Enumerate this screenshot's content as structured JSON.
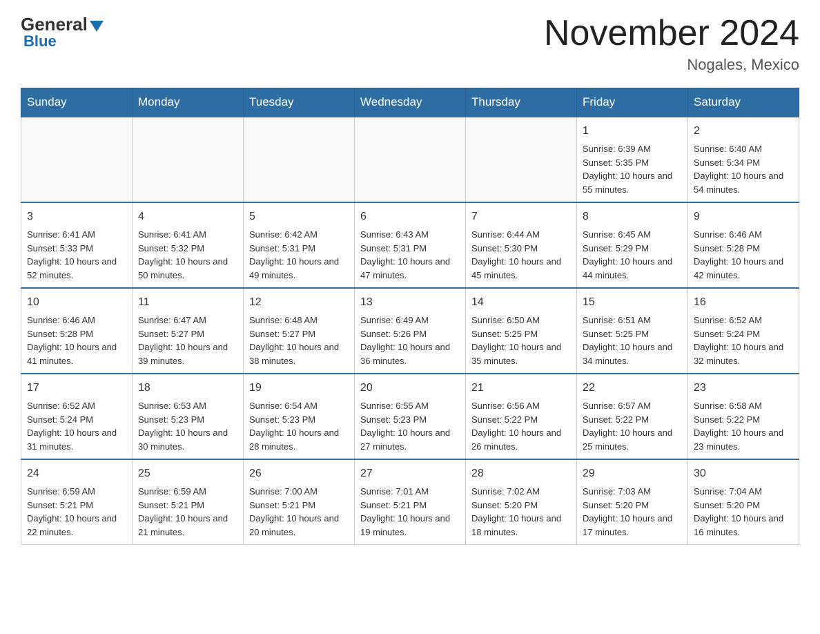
{
  "logo": {
    "general": "General",
    "blue": "Blue"
  },
  "header": {
    "title": "November 2024",
    "location": "Nogales, Mexico"
  },
  "days_of_week": [
    "Sunday",
    "Monday",
    "Tuesday",
    "Wednesday",
    "Thursday",
    "Friday",
    "Saturday"
  ],
  "weeks": [
    [
      {
        "day": "",
        "info": ""
      },
      {
        "day": "",
        "info": ""
      },
      {
        "day": "",
        "info": ""
      },
      {
        "day": "",
        "info": ""
      },
      {
        "day": "",
        "info": ""
      },
      {
        "day": "1",
        "info": "Sunrise: 6:39 AM\nSunset: 5:35 PM\nDaylight: 10 hours and 55 minutes."
      },
      {
        "day": "2",
        "info": "Sunrise: 6:40 AM\nSunset: 5:34 PM\nDaylight: 10 hours and 54 minutes."
      }
    ],
    [
      {
        "day": "3",
        "info": "Sunrise: 6:41 AM\nSunset: 5:33 PM\nDaylight: 10 hours and 52 minutes."
      },
      {
        "day": "4",
        "info": "Sunrise: 6:41 AM\nSunset: 5:32 PM\nDaylight: 10 hours and 50 minutes."
      },
      {
        "day": "5",
        "info": "Sunrise: 6:42 AM\nSunset: 5:31 PM\nDaylight: 10 hours and 49 minutes."
      },
      {
        "day": "6",
        "info": "Sunrise: 6:43 AM\nSunset: 5:31 PM\nDaylight: 10 hours and 47 minutes."
      },
      {
        "day": "7",
        "info": "Sunrise: 6:44 AM\nSunset: 5:30 PM\nDaylight: 10 hours and 45 minutes."
      },
      {
        "day": "8",
        "info": "Sunrise: 6:45 AM\nSunset: 5:29 PM\nDaylight: 10 hours and 44 minutes."
      },
      {
        "day": "9",
        "info": "Sunrise: 6:46 AM\nSunset: 5:28 PM\nDaylight: 10 hours and 42 minutes."
      }
    ],
    [
      {
        "day": "10",
        "info": "Sunrise: 6:46 AM\nSunset: 5:28 PM\nDaylight: 10 hours and 41 minutes."
      },
      {
        "day": "11",
        "info": "Sunrise: 6:47 AM\nSunset: 5:27 PM\nDaylight: 10 hours and 39 minutes."
      },
      {
        "day": "12",
        "info": "Sunrise: 6:48 AM\nSunset: 5:27 PM\nDaylight: 10 hours and 38 minutes."
      },
      {
        "day": "13",
        "info": "Sunrise: 6:49 AM\nSunset: 5:26 PM\nDaylight: 10 hours and 36 minutes."
      },
      {
        "day": "14",
        "info": "Sunrise: 6:50 AM\nSunset: 5:25 PM\nDaylight: 10 hours and 35 minutes."
      },
      {
        "day": "15",
        "info": "Sunrise: 6:51 AM\nSunset: 5:25 PM\nDaylight: 10 hours and 34 minutes."
      },
      {
        "day": "16",
        "info": "Sunrise: 6:52 AM\nSunset: 5:24 PM\nDaylight: 10 hours and 32 minutes."
      }
    ],
    [
      {
        "day": "17",
        "info": "Sunrise: 6:52 AM\nSunset: 5:24 PM\nDaylight: 10 hours and 31 minutes."
      },
      {
        "day": "18",
        "info": "Sunrise: 6:53 AM\nSunset: 5:23 PM\nDaylight: 10 hours and 30 minutes."
      },
      {
        "day": "19",
        "info": "Sunrise: 6:54 AM\nSunset: 5:23 PM\nDaylight: 10 hours and 28 minutes."
      },
      {
        "day": "20",
        "info": "Sunrise: 6:55 AM\nSunset: 5:23 PM\nDaylight: 10 hours and 27 minutes."
      },
      {
        "day": "21",
        "info": "Sunrise: 6:56 AM\nSunset: 5:22 PM\nDaylight: 10 hours and 26 minutes."
      },
      {
        "day": "22",
        "info": "Sunrise: 6:57 AM\nSunset: 5:22 PM\nDaylight: 10 hours and 25 minutes."
      },
      {
        "day": "23",
        "info": "Sunrise: 6:58 AM\nSunset: 5:22 PM\nDaylight: 10 hours and 23 minutes."
      }
    ],
    [
      {
        "day": "24",
        "info": "Sunrise: 6:59 AM\nSunset: 5:21 PM\nDaylight: 10 hours and 22 minutes."
      },
      {
        "day": "25",
        "info": "Sunrise: 6:59 AM\nSunset: 5:21 PM\nDaylight: 10 hours and 21 minutes."
      },
      {
        "day": "26",
        "info": "Sunrise: 7:00 AM\nSunset: 5:21 PM\nDaylight: 10 hours and 20 minutes."
      },
      {
        "day": "27",
        "info": "Sunrise: 7:01 AM\nSunset: 5:21 PM\nDaylight: 10 hours and 19 minutes."
      },
      {
        "day": "28",
        "info": "Sunrise: 7:02 AM\nSunset: 5:20 PM\nDaylight: 10 hours and 18 minutes."
      },
      {
        "day": "29",
        "info": "Sunrise: 7:03 AM\nSunset: 5:20 PM\nDaylight: 10 hours and 17 minutes."
      },
      {
        "day": "30",
        "info": "Sunrise: 7:04 AM\nSunset: 5:20 PM\nDaylight: 10 hours and 16 minutes."
      }
    ]
  ]
}
